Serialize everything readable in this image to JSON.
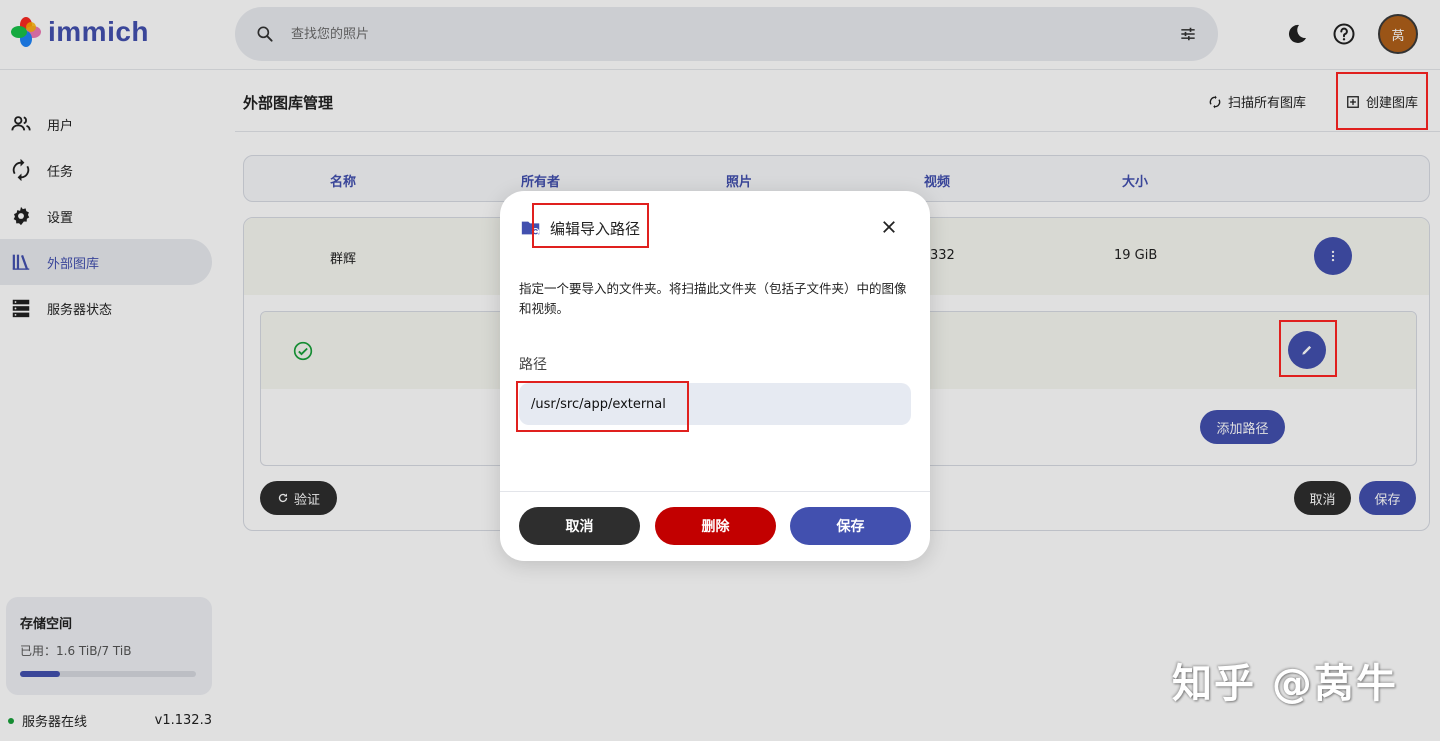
{
  "app": {
    "name": "immich"
  },
  "search": {
    "placeholder": "查找您的照片"
  },
  "header": {
    "avatar_initial": "莴"
  },
  "sidebar": {
    "items": [
      {
        "label": "用户"
      },
      {
        "label": "任务"
      },
      {
        "label": "设置"
      },
      {
        "label": "外部图库"
      },
      {
        "label": "服务器状态"
      }
    ],
    "storage": {
      "title": "存储空间",
      "used": "已用：1.6 TiB/7 TiB",
      "used_fraction": 0.23
    },
    "server_status": "服务器在线",
    "version": "v1.132.3"
  },
  "main": {
    "title": "外部图库管理",
    "scan_all_label": "扫描所有图库",
    "create_label": "创建图库",
    "columns": [
      "名称",
      "所有者",
      "照片",
      "视频",
      "大小"
    ],
    "row": {
      "name": "群辉",
      "videos_visible": "332",
      "size": "19 GiB"
    },
    "add_path_label": "添加路径",
    "validate_label": "验证",
    "cancel_label": "取消",
    "save_label": "保存"
  },
  "modal": {
    "title": "编辑导入路径",
    "description": "指定一个要导入的文件夹。将扫描此文件夹（包括子文件夹）中的图像和视频。",
    "field_label": "路径",
    "path_value": "/usr/src/app/external",
    "cancel_label": "取消",
    "delete_label": "删除",
    "save_label": "保存"
  },
  "watermark": "知乎 @莴牛",
  "colors": {
    "accent": "#4250af",
    "danger": "#c20000",
    "dark": "#2e2e2e",
    "highlight": "#e0201e"
  }
}
